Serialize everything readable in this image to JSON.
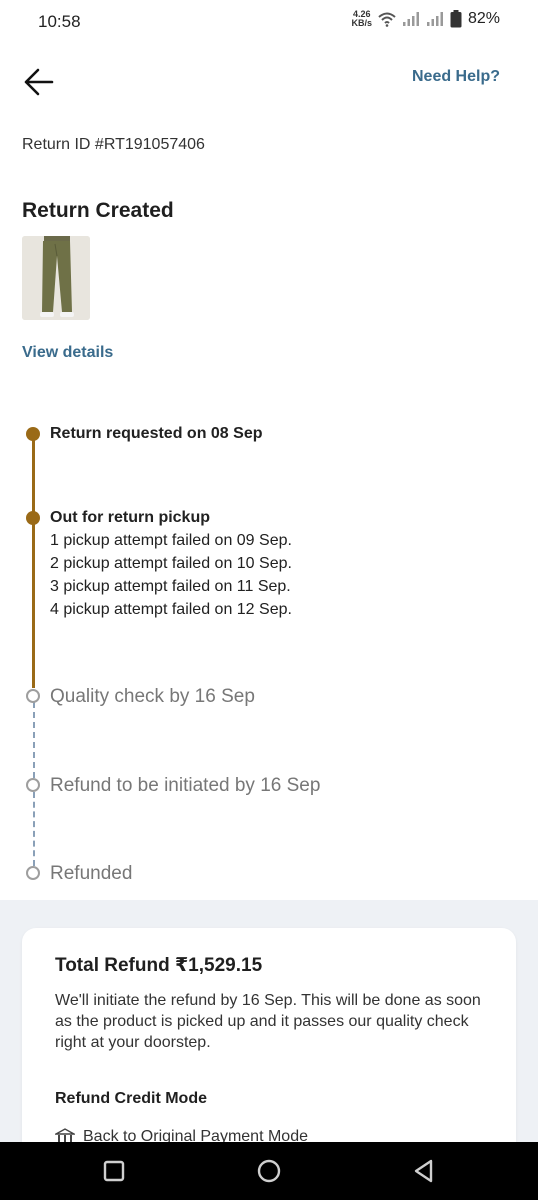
{
  "status_bar": {
    "time": "10:58",
    "net_speed_value": "4.26",
    "net_speed_unit": "KB/s",
    "battery": "82%",
    "icons": [
      "wifi-icon",
      "signal-icon",
      "signal-icon",
      "battery-icon"
    ]
  },
  "header": {
    "back_icon": "arrow-left-icon",
    "help_label": "Need Help?"
  },
  "return": {
    "id_text": "Return ID #RT191057406",
    "status_title": "Return Created",
    "view_details_label": "View details"
  },
  "timeline": {
    "steps": [
      {
        "title": "Return requested on 08 Sep",
        "state": "done"
      },
      {
        "title": "Out for return pickup",
        "state": "done",
        "details": [
          "1 pickup attempt failed on 09 Sep.",
          "2 pickup attempt failed on 10 Sep.",
          "3 pickup attempt failed on 11 Sep.",
          "4 pickup attempt failed on 12 Sep."
        ]
      },
      {
        "title": "Quality check by 16 Sep",
        "state": "pending"
      },
      {
        "title": "Refund to be initiated by 16 Sep",
        "state": "pending"
      },
      {
        "title": "Refunded",
        "state": "pending"
      }
    ],
    "colors": {
      "done": "#9a6a17",
      "pending": "#9e9e9e",
      "dashed": "#8aa0b8"
    }
  },
  "refund": {
    "title": "Total Refund ₹1,529.15",
    "description": "We'll initiate the refund by 16 Sep. This will be done as soon as the product is picked up and it passes our quality check right at your doorstep.",
    "mode_label": "Refund Credit Mode",
    "mode_value": "Back to Original Payment Mode",
    "mode_icon": "bank-icon"
  },
  "nav_bar": {
    "icons": [
      "recents-icon",
      "home-icon",
      "back-icon"
    ]
  },
  "colors": {
    "accent_link": "#3a6b8c",
    "timeline_done": "#9a6a17",
    "background_band": "#eef1f5"
  }
}
